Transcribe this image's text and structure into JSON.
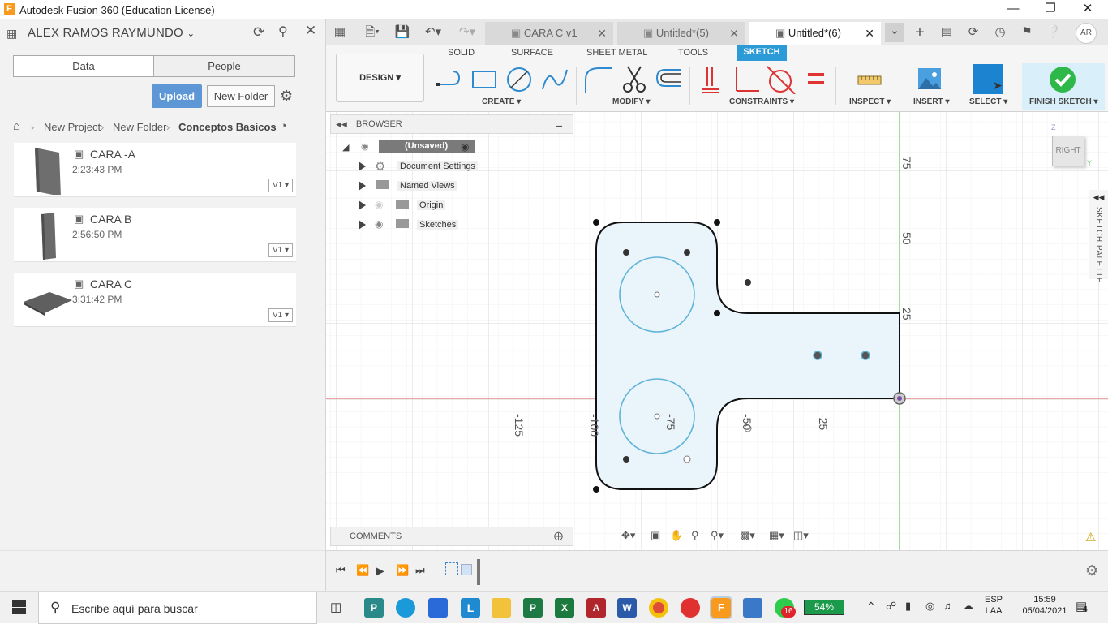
{
  "app": {
    "title": "Autodesk Fusion 360 (Education License)",
    "logo": "F"
  },
  "window_controls": [
    "minimize-icon",
    "restore-icon",
    "close-icon"
  ],
  "data_panel": {
    "user": "ALEX RAMOS RAYMUNDO",
    "tabs": [
      "Data",
      "People"
    ],
    "upload": "Upload",
    "new_folder": "New Folder",
    "breadcrumb": [
      "New Project",
      "New Folder",
      "Conceptos Basicos"
    ],
    "files": [
      {
        "name": "CARA -A",
        "time": "2:23:43 PM",
        "version": "V1"
      },
      {
        "name": "CARA B",
        "time": "2:56:50 PM",
        "version": "V1"
      },
      {
        "name": "CARA C",
        "time": "3:31:42 PM",
        "version": "V1"
      }
    ]
  },
  "doc_tabs": [
    {
      "label": "CARA C v1",
      "active": false
    },
    {
      "label": "Untitled*(5)",
      "active": false
    },
    {
      "label": "Untitled*(6)",
      "active": true
    }
  ],
  "user_initials": "AR",
  "toolbar": {
    "workspace": "DESIGN",
    "tabs": [
      "SOLID",
      "SURFACE",
      "SHEET METAL",
      "TOOLS",
      "SKETCH"
    ],
    "active_tab": "SKETCH",
    "groups": [
      "CREATE",
      "MODIFY",
      "CONSTRAINTS",
      "INSPECT",
      "INSERT",
      "SELECT",
      "FINISH SKETCH"
    ]
  },
  "browser": {
    "title": "BROWSER",
    "root": "(Unsaved)",
    "items": [
      "Document Settings",
      "Named Views",
      "Origin",
      "Sketches"
    ]
  },
  "comments": "COMMENTS",
  "viewcube": {
    "face": "RIGHT",
    "axis_z": "Z",
    "axis_y": "Y"
  },
  "sketch_palette": "SKETCH PALETTE",
  "axis_labels": {
    "horizontal": [
      "-125",
      "-100",
      "-75",
      "-50",
      "-25"
    ],
    "vertical": [
      "75",
      "50",
      "25"
    ]
  },
  "colors": {
    "accent": "#2d9ad8",
    "finish": "#2eb84a",
    "sketch_fill": "#eaf4fb",
    "sketch_circle": "#5fb4d8",
    "x_axis": "#e05050",
    "y_axis": "#50c050"
  },
  "taskbar": {
    "search_placeholder": "Escribe aquí para buscar",
    "battery": "54%",
    "lang1": "ESP",
    "lang2": "LAA",
    "time": "15:59",
    "date": "05/04/2021",
    "notifications": "4",
    "whatsapp_badge": "16"
  }
}
